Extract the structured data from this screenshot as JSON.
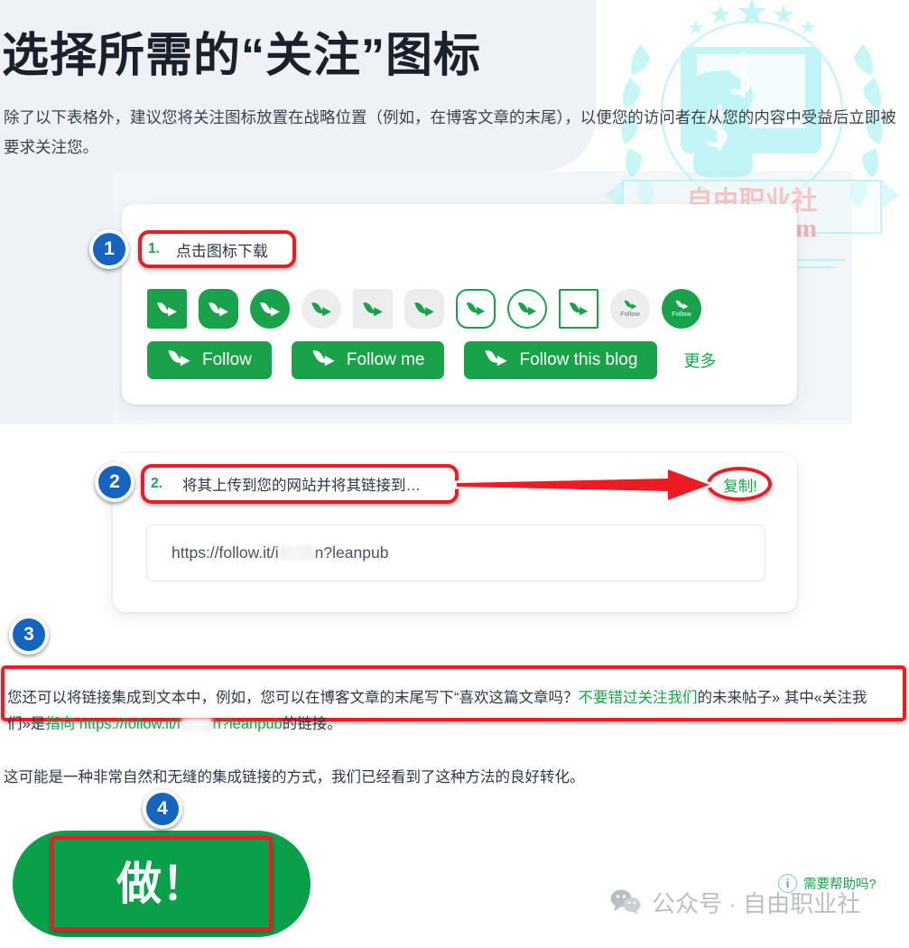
{
  "page": {
    "title": "选择所需的“关注”图标",
    "intro": "除了以下表格外，建议您将关注图标放置在战略位置（例如，在博客文章的末尾），以便您的访问者在从您的内容中受益后立即被要求关注您。",
    "closing": "这可能是一种非常自然和无缝的集成链接的方式，我们已经看到了这种方法的良好转化。"
  },
  "colors": {
    "brand_green": "#1aa24a",
    "badge_blue": "#1565c0",
    "annotation_red": "#ed1c24",
    "panel_gray": "#eef2f6",
    "watermark_cyan": "#9ef0f0"
  },
  "steps": {
    "one": {
      "number": "1",
      "list_number": "1.",
      "heading": "点击图标下载"
    },
    "two": {
      "number": "2",
      "list_number": "2.",
      "heading": "将其上传到您的网站并将其链接到…",
      "copy_label": "复制!"
    },
    "three": {
      "number": "3"
    },
    "four": {
      "number": "4"
    }
  },
  "icons": {
    "shapes": [
      {
        "name": "icon-green-square",
        "style": "ic-sq",
        "label": ""
      },
      {
        "name": "icon-green-rounded-square",
        "style": "ic-rsq",
        "label": ""
      },
      {
        "name": "icon-green-circle",
        "style": "ic-cir",
        "label": ""
      },
      {
        "name": "icon-gray-circle",
        "style": "ic-gcir",
        "label": ""
      },
      {
        "name": "icon-gray-square",
        "style": "ic-gsq",
        "label": ""
      },
      {
        "name": "icon-gray-rounded-square",
        "style": "ic-grsq",
        "label": ""
      },
      {
        "name": "icon-outline-rounded-square",
        "style": "ic-orsq",
        "label": ""
      },
      {
        "name": "icon-outline-circle",
        "style": "ic-ocir",
        "label": ""
      },
      {
        "name": "icon-outline-square",
        "style": "ic-osq",
        "label": ""
      },
      {
        "name": "icon-gray-circle-follow",
        "style": "ic-lblg",
        "label": "Follow"
      },
      {
        "name": "icon-green-circle-follow",
        "style": "ic-lblgr",
        "label": "Follow"
      }
    ]
  },
  "buttons": {
    "follow": "Follow",
    "follow_me": "Follow me",
    "follow_this_blog": "Follow this blog",
    "more": "更多",
    "do": "做！"
  },
  "url_field": {
    "prefix": "https://follow.it/i",
    "suffix": "n?leanpub"
  },
  "step3_text": {
    "p1": "您还可以将链接集成到文本中，例如，您可以在博客文章的末尾写下“喜欢这篇文章吗？",
    "green1": "不要错过关注我们",
    "p2": "的未来帖子» 其中«关注我们»是",
    "green2": "指向 https://follow.it/i",
    "green3": "n?leanpub",
    "p3": "的链接。"
  },
  "footer": {
    "help_text": "需要帮助吗?",
    "help_icon": "i",
    "wechat_text": "公众号 · 自由职业社"
  },
  "watermark": {
    "brand_cn": "自由职业社",
    "brand_en": "ieearn.com"
  }
}
